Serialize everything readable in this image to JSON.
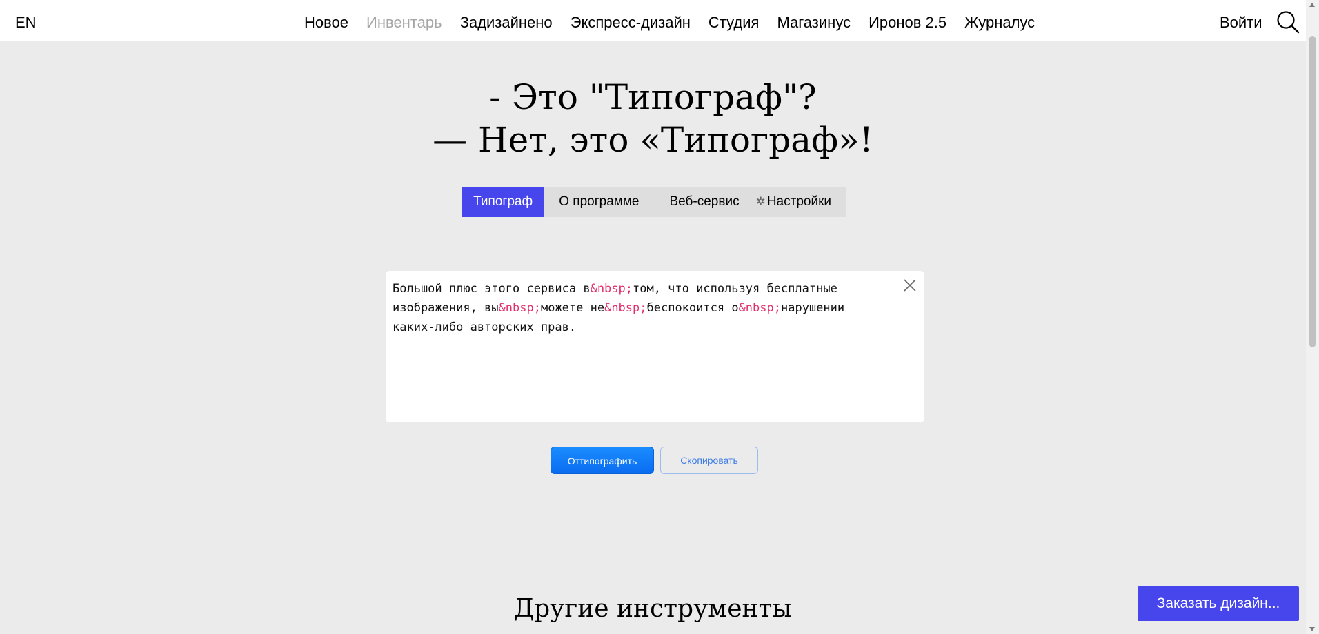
{
  "header": {
    "lang": "EN",
    "nav": [
      {
        "label": "Новое",
        "muted": false
      },
      {
        "label": "Инвентарь",
        "muted": true
      },
      {
        "label": "Задизайнено",
        "muted": false
      },
      {
        "label": "Экспресс-дизайн",
        "muted": false
      },
      {
        "label": "Студия",
        "muted": false
      },
      {
        "label": "Магазинус",
        "muted": false
      },
      {
        "label": "Иронов 2.5",
        "muted": false
      },
      {
        "label": "Журналус",
        "muted": false
      }
    ],
    "login": "Войти",
    "search_icon": "search-icon"
  },
  "hero": {
    "line1": "- Это \"Типограф\"?",
    "line2": "— Нет, это «Типограф»!"
  },
  "tabs": [
    {
      "label": "Типограф",
      "active": true
    },
    {
      "label": "О программе",
      "active": false
    },
    {
      "label": "Веб-сервис",
      "active": false
    },
    {
      "label": "Настройки",
      "active": false,
      "icon": "gear-icon"
    }
  ],
  "editor": {
    "line1": {
      "a": "Большой плюс этого сервиса в",
      "e1": "&nbsp;",
      "b": "том, что используя бесплатные"
    },
    "line2": {
      "a": "изображения, вы",
      "e1": "&nbsp;",
      "b": "можете не",
      "e2": "&nbsp;",
      "c": "беспокоится о",
      "e3": "&nbsp;",
      "d": "нарушении"
    },
    "line3": "каких-либо авторских прав.",
    "close_icon": "close-icon"
  },
  "actions": {
    "typograph": "Оттипографить",
    "copy": "Скопировать"
  },
  "section_title": "Другие инструменты",
  "order_button": "Заказать дизайн...",
  "colors": {
    "accent": "#4646ec",
    "primary_button": "#0a6cf0",
    "entity": "#e0306c",
    "background": "#ebebeb"
  }
}
